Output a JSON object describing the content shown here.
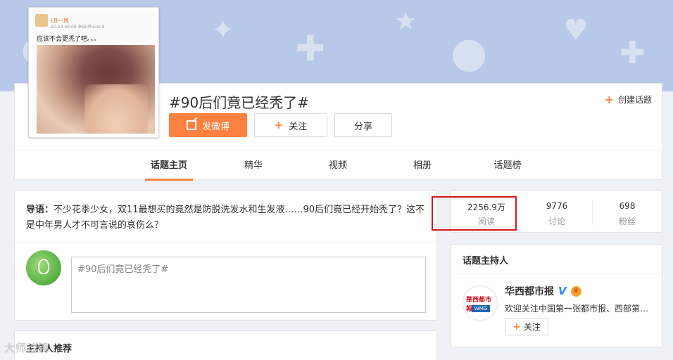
{
  "cover": {
    "username": "LB一周",
    "meta": "10-23 00:09 来自iPhone 8",
    "text": "应该不会更秃了吧。。。"
  },
  "topic": {
    "title": "#90后们竟已经秃了#",
    "create_label": "创建话题",
    "post_button": "发微博",
    "follow_button": "关注",
    "share_button": "分享"
  },
  "tabs": [
    {
      "label": "话题主页",
      "active": true
    },
    {
      "label": "精华",
      "active": false
    },
    {
      "label": "视频",
      "active": false
    },
    {
      "label": "相册",
      "active": false
    },
    {
      "label": "话题榜",
      "active": false
    }
  ],
  "intro": {
    "prefix": "导语：",
    "text": "不少花季少女，双11最想买的竟然是防脱洗发水和生发液……90后们竟已经开始秃了？这不是中年男人才不可言说的哀伤么？",
    "post_placeholder": "#90后们竟已经秃了#"
  },
  "bottom": {
    "title": "主持人推荐"
  },
  "stats": [
    {
      "value": "2256.9万",
      "label": "阅读"
    },
    {
      "value": "9776",
      "label": "讨论"
    },
    {
      "value": "698",
      "label": "粉丝"
    }
  ],
  "host": {
    "section_title": "话题主持人",
    "name": "华西都市报",
    "desc": "欢迎关注中国第一张都市报、西部第…",
    "follow_label": "关注",
    "logo_text": "華西都市報",
    "logo_sub": "WMG"
  },
  "watermark": "大师诊镜",
  "colors": {
    "accent": "#ff8140",
    "highlight": "#d9141c",
    "banner": "#b7c8e8",
    "verified": "#2b8cf0"
  }
}
